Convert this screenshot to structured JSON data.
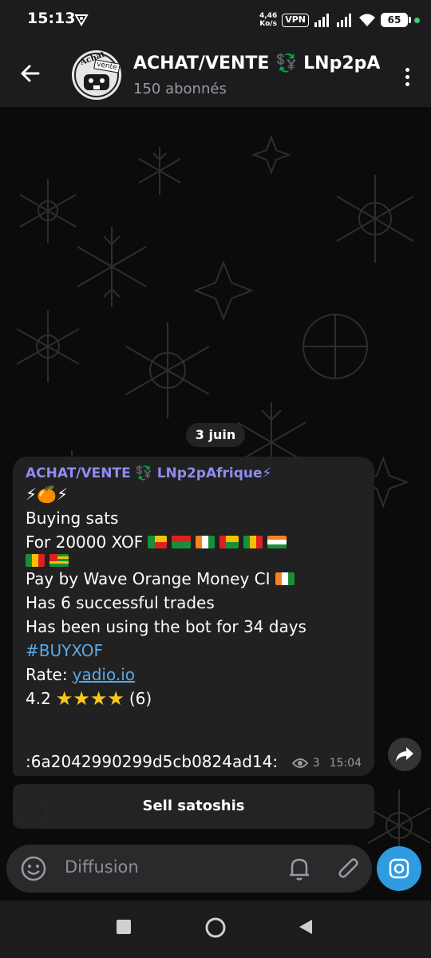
{
  "status_bar": {
    "time": "15:13",
    "net_speed_value": "4,46",
    "net_speed_unit": "Ko/s",
    "vpn": "VPN",
    "battery": "65"
  },
  "header": {
    "title": "ACHAT/VENTE 💱 LNp2pA",
    "subtitle": "150 abonnés",
    "avatar_text_top": "Achat",
    "avatar_text_bottom": "vente"
  },
  "chat": {
    "date": "3 juin",
    "message": {
      "sender": "ACHAT/VENTE 💱 LNp2pAfrique⚡",
      "emojis": "⚡🍊⚡",
      "line_buying": "Buying sats",
      "line_for": "For 20000 XOF",
      "line_pay": "Pay by Wave Orange Money CI",
      "line_trades": "Has 6 successful trades",
      "line_using": "Has been using the bot for 34 days",
      "hashtag": "#BUYXOF",
      "rate_label": "Rate:",
      "rate_link": "yadio.io",
      "rating_value": "4.2",
      "rating_stars": 4,
      "rating_count": "(6)",
      "code": ":6a2042990299d5cb0824ad14:",
      "views": "3",
      "time": "15:04"
    },
    "sell_button": "Sell satoshis"
  },
  "input": {
    "placeholder": "Diffusion"
  },
  "colors": {
    "sender": "#8f8cf2",
    "link": "#5aa9e6",
    "camera_button": "#2f9be0",
    "star": "#f9c81a"
  }
}
